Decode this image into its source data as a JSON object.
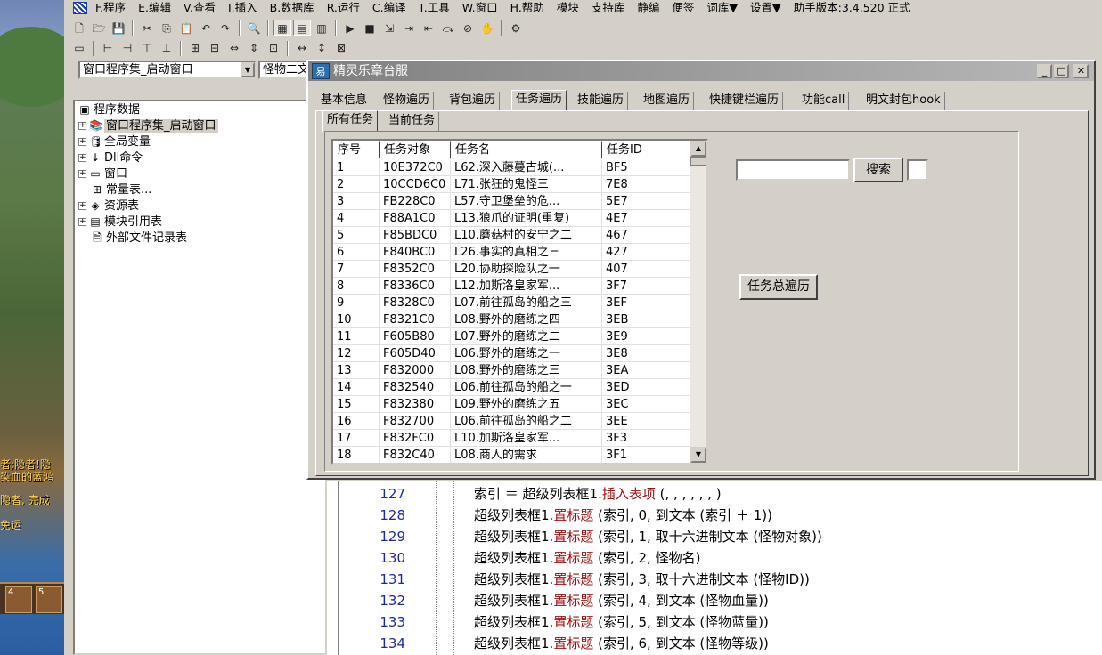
{
  "game": {
    "chat_lines": [
      "者;隐者!隐",
      "染血的蓝鸿",
      "隐者, 完成",
      "免运"
    ],
    "slots": [
      "4",
      "5"
    ]
  },
  "ide": {
    "menu": [
      "F.程序",
      "E.编辑",
      "V.查看",
      "I.插入",
      "B.数据库",
      "R.运行",
      "C.编译",
      "T.工具",
      "W.窗口",
      "H.帮助",
      "模块",
      "支持库",
      "静编",
      "便签",
      "词库▼",
      "设置▼",
      "助手版本:3.4.520 正式"
    ],
    "combo_left": "窗口程序集_启动窗口",
    "combo_right": "怪物二文",
    "tree": {
      "root": "程序数据",
      "items": [
        "窗口程序集_启动窗口",
        "全局变量",
        "Dll命令",
        "窗口",
        "常量表...",
        "资源表",
        "模块引用表",
        "外部文件记录表"
      ]
    },
    "code": [
      {
        "no": "127",
        "text": "索引 ＝ 超级列表框1.",
        "kw": "插入表项",
        "rest": " (, , , , , , )"
      },
      {
        "no": "128",
        "text": "超级列表框1.",
        "kw": "置标题",
        "rest": " (索引, 0, 到文本 (索引 ＋ 1))"
      },
      {
        "no": "129",
        "text": "超级列表框1.",
        "kw": "置标题",
        "rest": " (索引, 1, 取十六进制文本 (怪物对象))"
      },
      {
        "no": "130",
        "text": "超级列表框1.",
        "kw": "置标题",
        "rest": " (索引, 2, 怪物名)"
      },
      {
        "no": "131",
        "text": "超级列表框1.",
        "kw": "置标题",
        "rest": " (索引, 3, 取十六进制文本 (怪物ID))"
      },
      {
        "no": "132",
        "text": "超级列表框1.",
        "kw": "置标题",
        "rest": " (索引, 4, 到文本 (怪物血量))"
      },
      {
        "no": "133",
        "text": "超级列表框1.",
        "kw": "置标题",
        "rest": " (索引, 5, 到文本 (怪物蓝量))"
      },
      {
        "no": "134",
        "text": "超级列表框1.",
        "kw": "置标题",
        "rest": " (索引, 6, 到文本 (怪物等级))"
      }
    ]
  },
  "dialog": {
    "title": "精灵乐章台服",
    "app_icon": "易",
    "tabs": [
      "基本信息",
      "怪物遍历",
      "背包遍历",
      "任务遍历",
      "技能遍历",
      "地图遍历",
      "快捷键栏遍历",
      "功能call",
      "明文封包hook"
    ],
    "active_tab": 3,
    "subtabs": [
      "所有任务",
      "当前任务"
    ],
    "active_subtab": 0,
    "columns": [
      "序号",
      "任务对象",
      "任务名",
      "任务ID"
    ],
    "rows": [
      [
        "1",
        "10E372C0",
        "L62.深入藤蔓古城(...",
        "BF5"
      ],
      [
        "2",
        "10CCD6C0",
        "L71.张狂的鬼怪三",
        "7E8"
      ],
      [
        "3",
        "FB228C0",
        "L57.守卫堡垒的危...",
        "5E7"
      ],
      [
        "4",
        "F88A1C0",
        "L13.狼爪的证明(重复)",
        "4E7"
      ],
      [
        "5",
        "F85BDC0",
        "L10.蘑菇村的安宁之二",
        "467"
      ],
      [
        "6",
        "F840BC0",
        "L26.事实的真相之三",
        "427"
      ],
      [
        "7",
        "F8352C0",
        "L20.协助探险队之一",
        "407"
      ],
      [
        "8",
        "F8336C0",
        "L12.加斯洛皇家军...",
        "3F7"
      ],
      [
        "9",
        "F8328C0",
        "L07.前往孤岛的船之三",
        "3EF"
      ],
      [
        "10",
        "F8321C0",
        "L08.野外的磨练之四",
        "3EB"
      ],
      [
        "11",
        "F605B80",
        "L07.野外的磨练之二",
        "3E9"
      ],
      [
        "12",
        "F605D40",
        "L06.野外的磨练之一",
        "3E8"
      ],
      [
        "13",
        "F832000",
        "L08.野外的磨练之三",
        "3EA"
      ],
      [
        "14",
        "F832540",
        "L06.前往孤岛的船之一",
        "3ED"
      ],
      [
        "15",
        "F832380",
        "L09.野外的磨练之五",
        "3EC"
      ],
      [
        "16",
        "F832700",
        "L06.前往孤岛的船之二",
        "3EE"
      ],
      [
        "17",
        "F832FC0",
        "L10.加斯洛皇家军...",
        "3F3"
      ],
      [
        "18",
        "F832C40",
        "L08.商人的需求",
        "3F1"
      ]
    ],
    "search_value": "",
    "search_button": "搜索",
    "traverse_button": "任务总遍历"
  }
}
